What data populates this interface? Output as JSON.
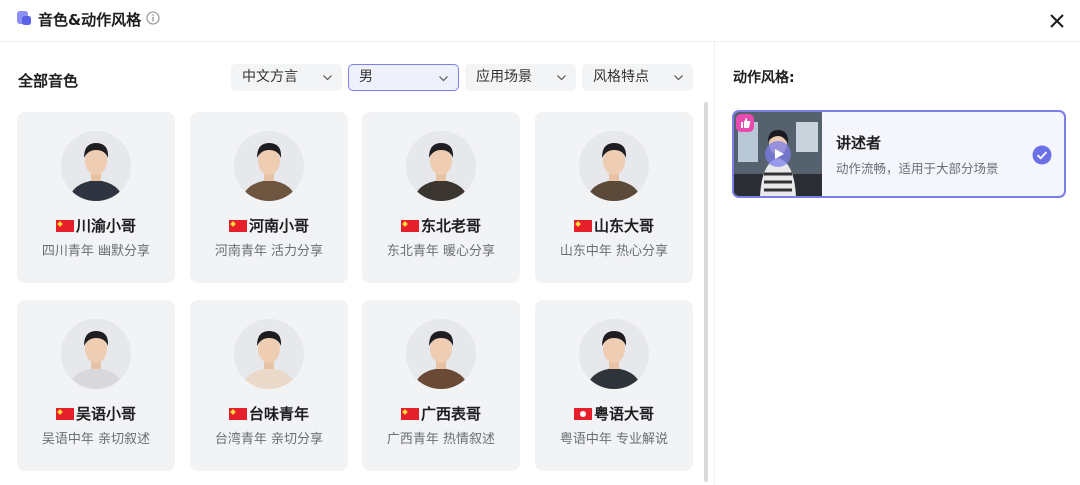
{
  "header": {
    "title": "音色&动作风格",
    "logo_icon": "voice-bubble-icon",
    "info_icon": "info-icon",
    "close_icon": "close-icon"
  },
  "voices": {
    "section_title": "全部音色",
    "filters": [
      {
        "label": "中文方言",
        "active": false
      },
      {
        "label": "男",
        "active": true
      },
      {
        "label": "应用场景",
        "active": false
      },
      {
        "label": "风格特点",
        "active": false
      }
    ],
    "cards": [
      {
        "flag": "cn",
        "name": "川渝小哥",
        "desc": "四川青年 幽默分享"
      },
      {
        "flag": "cn",
        "name": "河南小哥",
        "desc": "河南青年 活力分享"
      },
      {
        "flag": "cn",
        "name": "东北老哥",
        "desc": "东北青年 暖心分享"
      },
      {
        "flag": "cn",
        "name": "山东大哥",
        "desc": "山东中年 热心分享"
      },
      {
        "flag": "cn",
        "name": "吴语小哥",
        "desc": "吴语中年 亲切叙述"
      },
      {
        "flag": "cn",
        "name": "台味青年",
        "desc": "台湾青年 亲切分享"
      },
      {
        "flag": "cn",
        "name": "广西表哥",
        "desc": "广西青年 热情叙述"
      },
      {
        "flag": "hk",
        "name": "粤语大哥",
        "desc": "粤语中年 专业解说"
      }
    ]
  },
  "action_style": {
    "title": "动作风格:",
    "selected": {
      "name": "讲述者",
      "desc": "动作流畅，适用于大部分场景",
      "checked": true
    }
  },
  "colors": {
    "accent": "#7b7ee8",
    "card_bg": "#f2f3f5",
    "badge_pink": "#e94ab0"
  }
}
